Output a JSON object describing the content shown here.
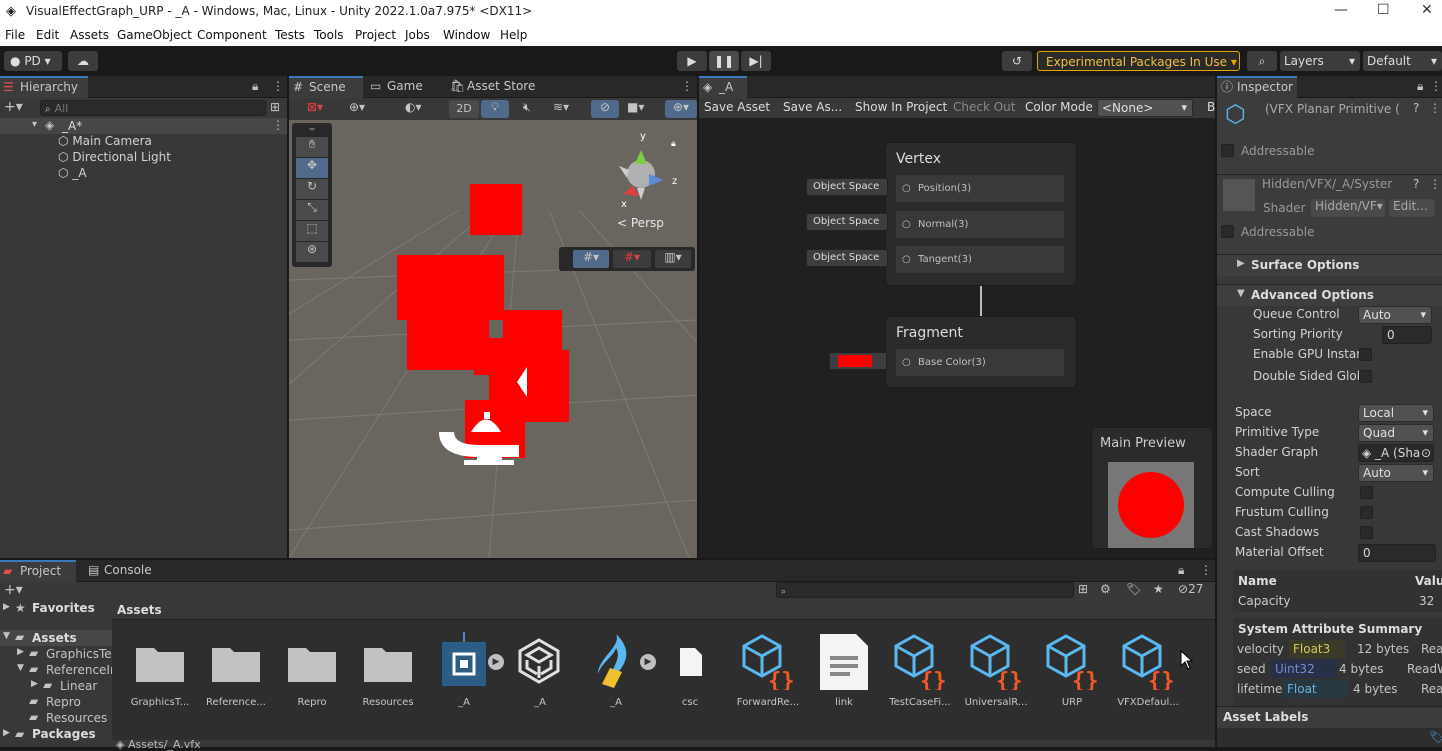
{
  "window": {
    "title": "VisualEffectGraph_URP - _A - Windows, Mac, Linux - Unity 2022.1.0a7.975* <DX11>",
    "min": "—",
    "max": "☐",
    "close": "✕"
  },
  "menu": [
    "File",
    "Edit",
    "Assets",
    "GameObject",
    "Component",
    "Tests",
    "Tools",
    "Project",
    "Jobs",
    "Window",
    "Help"
  ],
  "toolbar": {
    "account": "PD",
    "experimental": "Experimental Packages In Use",
    "layers": "Layers",
    "layout": "Default"
  },
  "hierarchy": {
    "tab": "Hierarchy",
    "search_placeholder": "All",
    "scene": "_A*",
    "items": [
      "Main Camera",
      "Directional Light",
      "_A"
    ]
  },
  "scene_tabs": [
    "Scene",
    "Game",
    "Asset Store"
  ],
  "scene": {
    "two_d": "2D",
    "persp": "Persp",
    "axis_x": "x",
    "axis_y": "y",
    "axis_z": "z"
  },
  "vfx": {
    "tab": "_A",
    "buttons": [
      "Save Asset",
      "Save As...",
      "Show In Project",
      "Check Out",
      "Color Mode"
    ],
    "color_mode": "<None>",
    "extra": "B",
    "vertex": {
      "title": "Vertex",
      "ports": [
        {
          "space": "Object Space",
          "label": "Position(3)"
        },
        {
          "space": "Object Space",
          "label": "Normal(3)"
        },
        {
          "space": "Object Space",
          "label": "Tangent(3)"
        }
      ]
    },
    "fragment": {
      "title": "Fragment",
      "ports": [
        {
          "label": "Base Color(3)"
        }
      ]
    },
    "preview": "Main Preview"
  },
  "inspector": {
    "tab": "Inspector",
    "title": "(VFX Planar Primitive (",
    "addressable": "Addressable",
    "shader_asset": "Hidden/VFX/_A/Syster",
    "shader_label": "Shader",
    "shader_value": "Hidden/VF▾",
    "edit": "Edit...",
    "surface": "Surface Options",
    "advanced": "Advanced Options",
    "adv": [
      {
        "label": "Queue Control",
        "dd": "Auto"
      },
      {
        "label": "Sorting Priority",
        "num": "0"
      },
      {
        "label": "Enable GPU Instan"
      },
      {
        "label": "Double Sided Glob"
      }
    ],
    "props": [
      {
        "label": "Space",
        "dd": "Local"
      },
      {
        "label": "Primitive Type",
        "dd": "Quad"
      },
      {
        "label": "Shader Graph",
        "obj": "_A (Shac"
      },
      {
        "label": "Sort",
        "dd": "Auto"
      },
      {
        "label": "Compute Culling"
      },
      {
        "label": "Frustum Culling"
      },
      {
        "label": "Cast Shadows"
      },
      {
        "label": "Material Offset",
        "num": "0"
      }
    ],
    "table": {
      "h1": "Name",
      "h2": "Valu",
      "r1": "Capacity",
      "r1v": "32"
    },
    "sys": {
      "title": "System Attribute Summary",
      "rows": [
        {
          "name": "velocity",
          "type": "Float3",
          "size": "12 bytes",
          "rw": "Rea"
        },
        {
          "name": "seed",
          "type": "Uint32",
          "size": "4 bytes",
          "rw": "ReadW"
        },
        {
          "name": "lifetime",
          "type": "Float",
          "size": "4 bytes",
          "rw": "Rea"
        }
      ]
    },
    "labels": "Asset Labels"
  },
  "project": {
    "tabs": [
      "Project",
      "Console"
    ],
    "count": "27",
    "favorites": "Favorites",
    "assets_root": "Assets",
    "tree": [
      "GraphicsTe",
      "ReferenceIn",
      "Linear",
      "Repro",
      "Resources"
    ],
    "packages": "Packages",
    "header": "Assets",
    "path": "Assets/_A.vfx",
    "items": [
      "GraphicsT...",
      "Reference...",
      "Repro",
      "Resources",
      "_A",
      "_A",
      "_A",
      "csc",
      "ForwardRe...",
      "link",
      "TestCaseFi...",
      "UniversalR...",
      "URP",
      "VFXDefaul..."
    ]
  },
  "colors": {
    "accent": "#3a79bb",
    "red": "#ff0000",
    "experimental": "#e6a800"
  }
}
